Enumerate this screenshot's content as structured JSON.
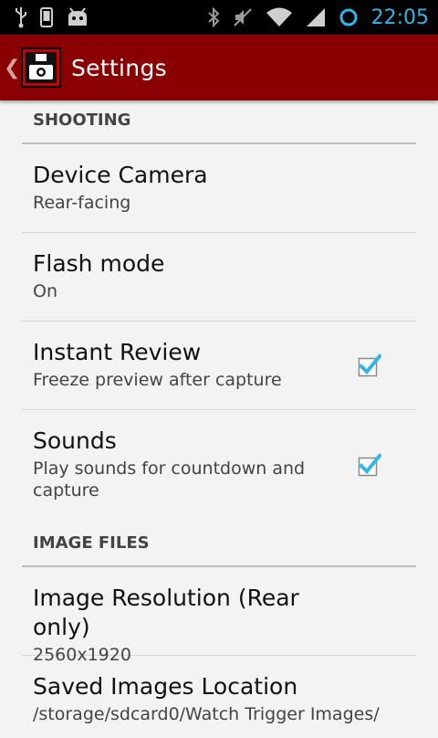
{
  "status_bar": {
    "time": "22:05",
    "left_icons": [
      "usb-icon",
      "phone-icon",
      "android-debug-icon"
    ],
    "right_icons": [
      "bluetooth-icon",
      "vibrate-off-icon",
      "wifi-icon",
      "signal-icon",
      "sync-circle-icon"
    ],
    "time_color": "#33b5e5"
  },
  "action_bar": {
    "title": "Settings",
    "background": "#8a0000",
    "app_icon": "camera-trigger-icon"
  },
  "sections": [
    {
      "header": "SHOOTING",
      "items": [
        {
          "title": "Device Camera",
          "summary": "Rear-facing",
          "checkbox": false
        },
        {
          "title": "Flash mode",
          "summary": "On",
          "checkbox": false
        },
        {
          "title": "Instant Review",
          "summary": "Freeze preview after capture",
          "checkbox": true,
          "checked": true
        },
        {
          "title": "Sounds",
          "summary": "Play sounds for countdown and capture",
          "checkbox": true,
          "checked": true
        }
      ]
    },
    {
      "header": "IMAGE FILES",
      "items": [
        {
          "title": "Image Resolution (Rear only)",
          "summary": "2560x1920",
          "checkbox": false
        },
        {
          "title": "Saved Images Location",
          "summary": "/storage/sdcard0/Watch Trigger Images/",
          "checkbox": false
        }
      ]
    }
  ],
  "colors": {
    "check_blue": "#33b5e5",
    "divider": "#bdbdbd"
  }
}
